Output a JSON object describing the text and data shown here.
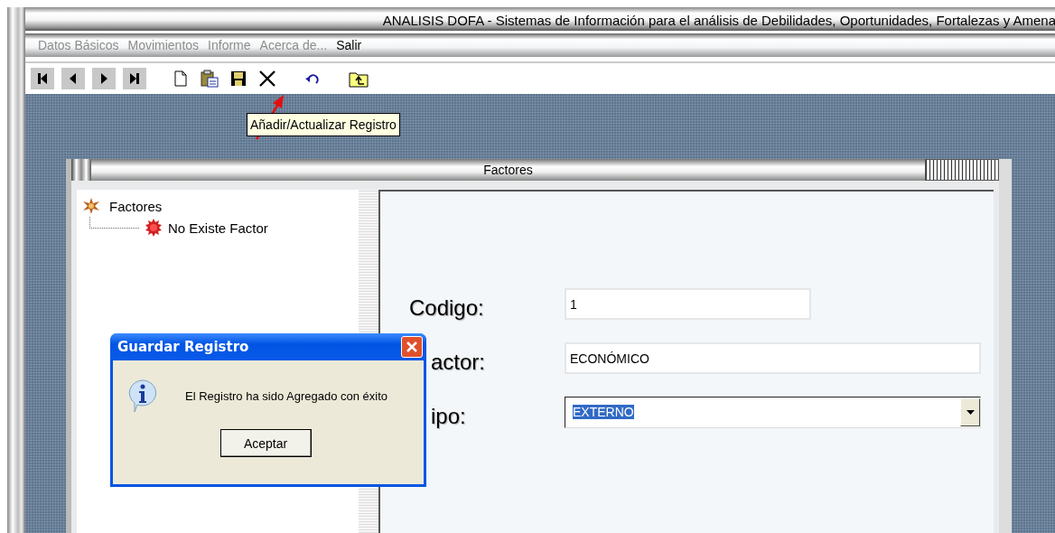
{
  "window": {
    "title": "ANALISIS DOFA - Sistemas de Información para el análisis de Debilidades, Oportunidades, Fortalezas y Amena"
  },
  "menu": [
    {
      "label": "Datos Básicos",
      "disabled": true
    },
    {
      "label": "Movimientos",
      "disabled": true
    },
    {
      "label": "Informe",
      "disabled": true
    },
    {
      "label": "Acerca de...",
      "disabled": true
    },
    {
      "label": "Salir",
      "disabled": false
    }
  ],
  "tooltip": {
    "text": "Añadir/Actualizar Registro"
  },
  "child_window": {
    "title": "Factores",
    "tree": [
      {
        "label": "Factores",
        "children": [
          {
            "label": "No Existe Factor"
          }
        ]
      }
    ],
    "fields": [
      {
        "label": "Codigo:",
        "kind": "text",
        "value": "1",
        "highlighted": false
      },
      {
        "label": "actor:",
        "kind": "text",
        "value": "ECONÓMICO",
        "highlighted": false
      },
      {
        "label": "ipo:",
        "kind": "dropdown",
        "value": "EXTERNO",
        "highlighted": true
      }
    ]
  },
  "dialog": {
    "title": "Guardar Registro",
    "message": "El Registro ha sido Agregado con éxito",
    "buttons": [
      "Aceptar"
    ]
  }
}
